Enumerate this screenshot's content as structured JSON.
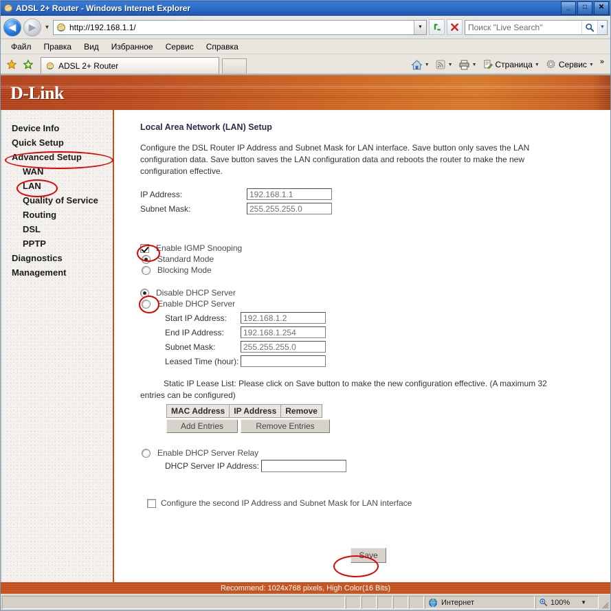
{
  "window": {
    "title": "ADSL 2+ Router - Windows Internet Explorer",
    "minimize": "_",
    "maximize": "□",
    "close": "✕"
  },
  "nav": {
    "back_icon": "back-arrow-icon",
    "forward_icon": "forward-arrow-icon",
    "history_caret": "▼",
    "address_value": "http://192.168.1.1/",
    "address_dropdown": "▼",
    "refresh_icon": "↻",
    "stop_icon": "✕",
    "search_placeholder": "Поиск \"Live Search\"",
    "search_go_icon": "search-icon",
    "search_caret": "▼"
  },
  "menu": {
    "items": [
      {
        "label": "Файл"
      },
      {
        "label": "Правка"
      },
      {
        "label": "Вид"
      },
      {
        "label": "Избранное"
      },
      {
        "label": "Сервис"
      },
      {
        "label": "Справка"
      }
    ]
  },
  "tabbar": {
    "favorites_icon": "star-icon",
    "add_favorite_icon": "add-favorite-icon",
    "tab_label": "ADSL 2+ Router",
    "new_tab_label": "",
    "tools": [
      {
        "label": "",
        "icon": "home-icon",
        "caret": "▼"
      },
      {
        "label": "",
        "icon": "rss-icon",
        "caret": "▼"
      },
      {
        "label": "",
        "icon": "print-icon",
        "caret": "▼"
      },
      {
        "label": "Страница",
        "icon": "page-icon",
        "caret": "▼"
      },
      {
        "label": "Сервис",
        "icon": "gear-icon",
        "caret": "▼"
      }
    ],
    "overflow": "»"
  },
  "brand": {
    "logo": "D-Link"
  },
  "sidebar": {
    "items": [
      {
        "label": "Device Info",
        "level": 1
      },
      {
        "label": "Quick Setup",
        "level": 1
      },
      {
        "label": "Advanced Setup",
        "level": 1
      },
      {
        "label": "WAN",
        "level": 2
      },
      {
        "label": "LAN",
        "level": 2
      },
      {
        "label": "Quality of Service",
        "level": 2
      },
      {
        "label": "Routing",
        "level": 2
      },
      {
        "label": "DSL",
        "level": 2
      },
      {
        "label": "PPTP",
        "level": 2
      },
      {
        "label": "Diagnostics",
        "level": 1
      },
      {
        "label": "Management",
        "level": 1
      }
    ]
  },
  "main": {
    "section_title": "Local Area Network (LAN) Setup",
    "description": "Configure the DSL Router IP Address and Subnet Mask for LAN interface.  Save button only saves the LAN configuration data.  Save button saves the LAN configuration data and reboots the router to make the new configuration effective.",
    "ip_address_label": "IP Address:",
    "ip_address_value": "192.168.1.1",
    "subnet_mask_label": "Subnet Mask:",
    "subnet_mask_value": "255.255.255.0",
    "igmp_snooping_label": "Enable IGMP Snooping",
    "igmp_snooping_checked": true,
    "standard_mode_label": "Standard Mode",
    "standard_mode_selected": true,
    "blocking_mode_label": "Blocking Mode",
    "blocking_mode_selected": false,
    "disable_dhcp_label": "Disable DHCP Server",
    "disable_dhcp_selected": true,
    "enable_dhcp_label": "Enable DHCP Server",
    "enable_dhcp_selected": false,
    "start_ip_label": "Start IP Address:",
    "start_ip_value": "192.168.1.2",
    "end_ip_label": "End IP Address:",
    "end_ip_value": "192.168.1.254",
    "dhcp_subnet_label": "Subnet Mask:",
    "dhcp_subnet_value": "255.255.255.0",
    "leased_time_label": "Leased Time (hour):",
    "leased_time_value": "",
    "lease_list_note": "Static IP Lease List: Please click on Save button to make the new configuration effective. (A maximum 32 entries can be configured)",
    "lease_table_headers": [
      "MAC Address",
      "IP Address",
      "Remove"
    ],
    "add_entries_label": "Add Entries",
    "remove_entries_label": "Remove Entries",
    "dhcp_relay_label": "Enable DHCP Server Relay",
    "dhcp_relay_selected": false,
    "dhcp_relay_ip_label": "DHCP Server IP Address:",
    "dhcp_relay_ip_value": "",
    "second_ip_label": "Configure the second IP Address and Subnet Mask for LAN interface",
    "second_ip_checked": false,
    "save_label": "Save"
  },
  "footer": {
    "recommend": "Recommend: 1024x768 pixels, High Color(16 Bits)"
  },
  "statusbar": {
    "message": "",
    "zone_icon": "globe-icon",
    "zone_label": "Интернет",
    "zoom_icon": "zoom-icon",
    "zoom_label": "100%",
    "zoom_caret": "▼"
  }
}
